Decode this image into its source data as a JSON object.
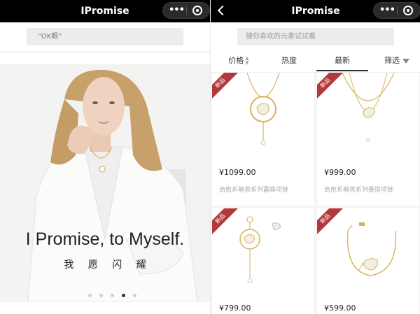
{
  "left": {
    "title": "IPromise",
    "search_placeholder": "“OK眼”",
    "hero": {
      "tagline": "I Promise, to Myself.",
      "subline": "我 愿 闪 耀"
    },
    "carousel": {
      "count": 5,
      "active_index": 3
    }
  },
  "right": {
    "title": "IPromise",
    "search_placeholder": "搜你喜欢的元素试试看",
    "filters": [
      {
        "label": "价格",
        "icon": "sort-icon"
      },
      {
        "label": "热度"
      },
      {
        "label": "最新",
        "active": true
      },
      {
        "label": "筛选",
        "icon": "funnel-icon"
      }
    ],
    "products": [
      {
        "badge": "新品",
        "price": "¥1099.00",
        "name": "治愈系萌兽系列露珠项链"
      },
      {
        "badge": "新品",
        "price": "¥999.00",
        "name": "治愈系萌兽系列叠搭项链"
      },
      {
        "badge": "新品",
        "price": "¥799.00",
        "name": ""
      },
      {
        "badge": "新品",
        "price": "¥599.00",
        "name": ""
      }
    ]
  },
  "colors": {
    "topbar": "#000000",
    "badge": "#b3383a",
    "gold": "#d8b15a"
  }
}
